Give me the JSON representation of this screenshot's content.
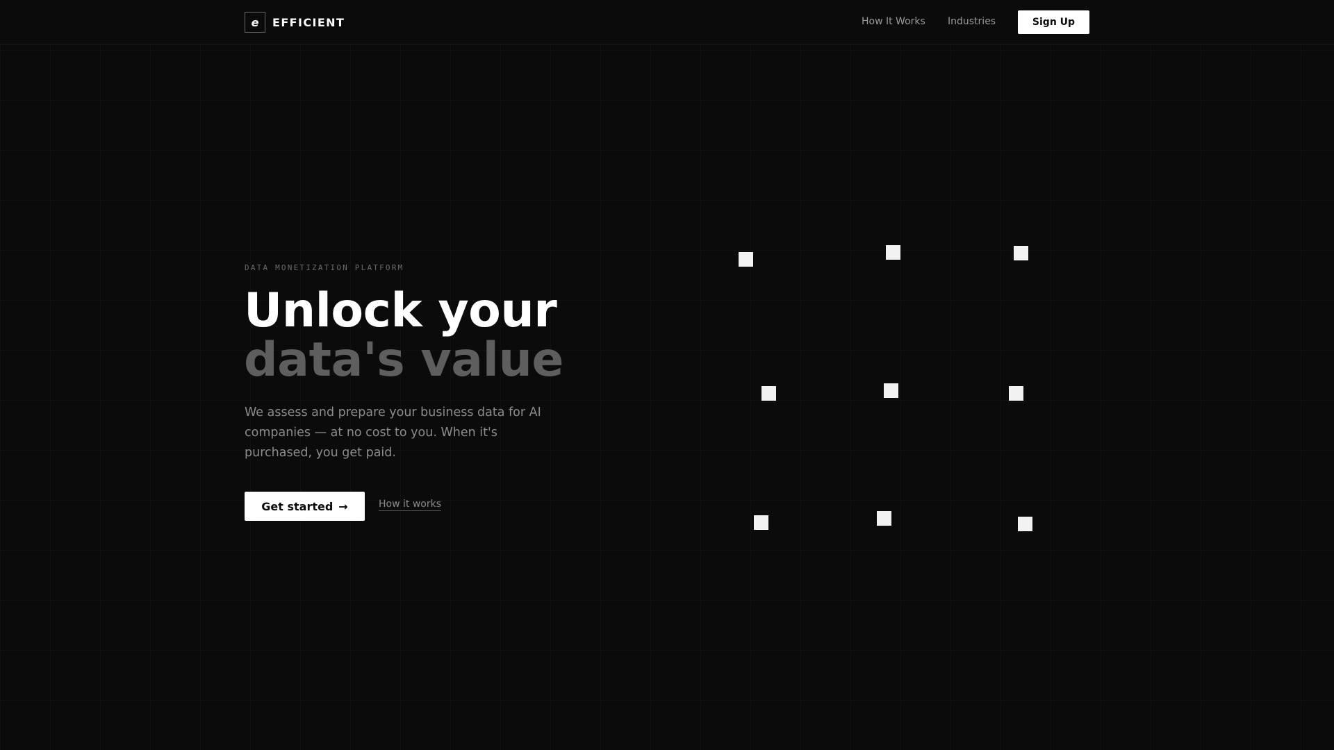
{
  "brand": {
    "logo_letter": "e",
    "name": "EFFICIENT"
  },
  "nav": {
    "links": [
      "How It Works",
      "Industries"
    ],
    "signup_label": "Sign Up"
  },
  "hero": {
    "eyebrow": "DATA MONETIZATION PLATFORM",
    "headline_line1": "Unlock your",
    "headline_line2": "data's value",
    "description": "We assess and prepare your business data for AI companies — at no cost to you. When it's purchased, you get paid.",
    "cta_label": "Get started",
    "cta_arrow": "→",
    "secondary_label": "How it works"
  },
  "colors": {
    "background": "#0b0b0b",
    "primary_text": "#ffffff",
    "muted_text": "#8c8c8c",
    "headline_dim": "#5e5e5e",
    "button_bg": "#ffffff"
  }
}
